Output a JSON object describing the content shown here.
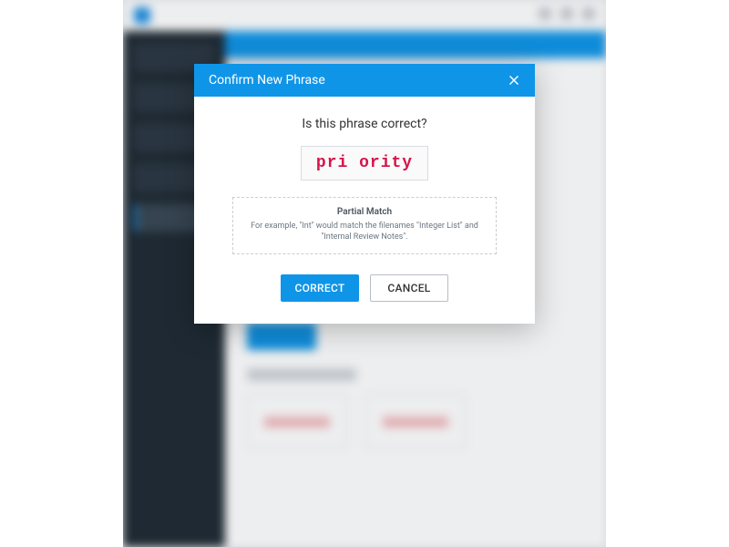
{
  "modal": {
    "title": "Confirm New Phrase",
    "question": "Is this phrase correct?",
    "phrase": "pri ority",
    "hint_title": "Partial Match",
    "hint_text": "For example, \"Int\" would match the filenames \"Integer List\" and \"Internal Review Notes\".",
    "correct_label": "CORRECT",
    "cancel_label": "CANCEL"
  }
}
